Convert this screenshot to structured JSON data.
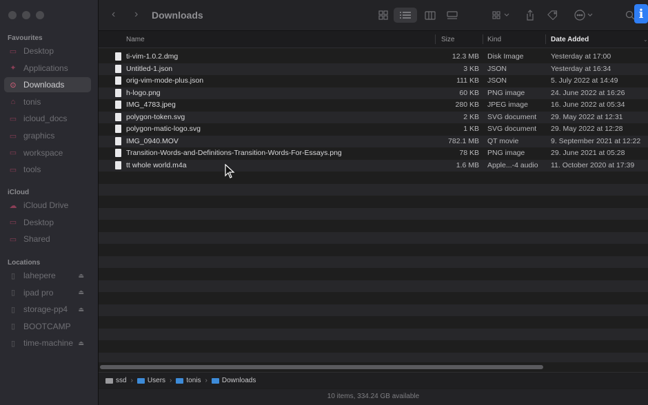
{
  "sidebar": {
    "favourites_title": "Favourites",
    "favourites": [
      {
        "label": "Desktop",
        "icon": "desktop-icon"
      },
      {
        "label": "Applications",
        "icon": "applications-icon"
      },
      {
        "label": "Downloads",
        "icon": "downloads-icon"
      },
      {
        "label": "tonis",
        "icon": "home-icon"
      },
      {
        "label": "icloud_docs",
        "icon": "folder-icon"
      },
      {
        "label": "graphics",
        "icon": "folder-icon"
      },
      {
        "label": "workspace",
        "icon": "folder-icon"
      },
      {
        "label": "tools",
        "icon": "folder-icon"
      }
    ],
    "icloud_title": "iCloud",
    "icloud": [
      {
        "label": "iCloud Drive",
        "icon": "cloud-icon"
      },
      {
        "label": "Desktop",
        "icon": "desktop-icon"
      },
      {
        "label": "Shared",
        "icon": "shared-folder-icon"
      }
    ],
    "locations_title": "Locations",
    "locations": [
      {
        "label": "lahepere",
        "icon": "drive-icon"
      },
      {
        "label": "ipad pro",
        "icon": "ipad-icon"
      },
      {
        "label": "storage-pp4",
        "icon": "drive-icon"
      },
      {
        "label": "BOOTCAMP",
        "icon": "drive-icon"
      },
      {
        "label": "time-machine",
        "icon": "drive-icon"
      }
    ]
  },
  "toolbar": {
    "title": "Downloads",
    "back": "‹",
    "forward": "›"
  },
  "columns": {
    "name": "Name",
    "size": "Size",
    "kind": "Kind",
    "date_added": "Date Added"
  },
  "files": [
    {
      "name": "ti-vim-1.0.2.dmg",
      "size": "12.3 MB",
      "kind": "Disk Image",
      "date": "Yesterday at 17:00"
    },
    {
      "name": "Untitled-1.json",
      "size": "3 KB",
      "kind": "JSON",
      "date": "Yesterday at 16:34"
    },
    {
      "name": "orig-vim-mode-plus.json",
      "size": "111 KB",
      "kind": "JSON",
      "date": "5. July 2022 at 14:49"
    },
    {
      "name": "h-logo.png",
      "size": "60 KB",
      "kind": "PNG image",
      "date": "24. June 2022 at 16:26"
    },
    {
      "name": "IMG_4783.jpeg",
      "size": "280 KB",
      "kind": "JPEG image",
      "date": "16. June 2022 at 05:34"
    },
    {
      "name": "polygon-token.svg",
      "size": "2 KB",
      "kind": "SVG document",
      "date": "29. May 2022 at 12:31"
    },
    {
      "name": "polygon-matic-logo.svg",
      "size": "1 KB",
      "kind": "SVG document",
      "date": "29. May 2022 at 12:28"
    },
    {
      "name": "IMG_0940.MOV",
      "size": "782.1 MB",
      "kind": "QT movie",
      "date": "9. September 2021 at 12:22"
    },
    {
      "name": "Transition-Words-and-Definitions-Transition-Words-For-Essays.png",
      "size": "78 KB",
      "kind": "PNG image",
      "date": "29. June 2021 at 05:28"
    },
    {
      "name": "tt whole world.m4a",
      "size": "1.6 MB",
      "kind": "Apple...-4 audio",
      "date": "11. October 2020 at 17:39"
    }
  ],
  "pathbar": {
    "segments": [
      "ssd",
      "Users",
      "tonis",
      "Downloads"
    ]
  },
  "status": "10 items, 334.24 GB available",
  "colors": {
    "accent": "#2f7ef5",
    "sidebar_icon": "#e0617d",
    "folder": "#3d8bd8"
  }
}
